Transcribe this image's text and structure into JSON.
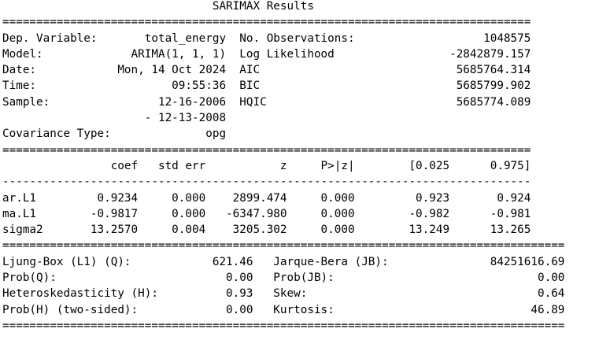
{
  "title": "SARIMAX Results",
  "sections": {
    "top_rule": "==============================================================================",
    "mid_rule": "==============================================================================",
    "dash_rule": "------------------------------------------------------------------------------",
    "bottom_rule_params": "===================================================================================",
    "bottom_rule_final": "==================================================================================="
  },
  "model_info": [
    {
      "left_label": "Dep. Variable:",
      "left_value": "total_energy",
      "right_label": "No. Observations:",
      "right_value": "1048575"
    },
    {
      "left_label": "Model:",
      "left_value": "ARIMA(1, 1, 1)",
      "right_label": "Log Likelihood",
      "right_value": "-2842879.157"
    },
    {
      "left_label": "Date:",
      "left_value": "Mon, 14 Oct 2024",
      "right_label": "AIC",
      "right_value": "5685764.314"
    },
    {
      "left_label": "Time:",
      "left_value": "09:55:36",
      "right_label": "BIC",
      "right_value": "5685799.902"
    },
    {
      "left_label": "Sample:",
      "left_value": "12-16-2006",
      "right_label": "HQIC",
      "right_value": "5685774.089"
    },
    {
      "left_label": "",
      "left_value": "- 12-13-2008",
      "right_label": "",
      "right_value": ""
    },
    {
      "left_label": "Covariance Type:",
      "left_value": "opg",
      "right_label": "",
      "right_value": ""
    }
  ],
  "coef_table": {
    "headers": [
      "",
      "coef",
      "std err",
      "z",
      "P>|z|",
      "[0.025",
      "0.975]"
    ],
    "rows": [
      [
        "ar.L1",
        "0.9234",
        "0.000",
        "2899.474",
        "0.000",
        "0.923",
        "0.924"
      ],
      [
        "ma.L1",
        "-0.9817",
        "0.000",
        "-6347.980",
        "0.000",
        "-0.982",
        "-0.981"
      ],
      [
        "sigma2",
        "13.2570",
        "0.004",
        "3205.302",
        "0.000",
        "13.249",
        "13.265"
      ]
    ]
  },
  "diagnostics": [
    {
      "left_label": "Ljung-Box (L1) (Q):",
      "left_value": "621.46",
      "right_label": "Jarque-Bera (JB):",
      "right_value": "84251616.69"
    },
    {
      "left_label": "Prob(Q):",
      "left_value": "0.00",
      "right_label": "Prob(JB):",
      "right_value": "0.00"
    },
    {
      "left_label": "Heteroskedasticity (H):",
      "left_value": "0.93",
      "right_label": "Skew:",
      "right_value": "0.64"
    },
    {
      "left_label": "Prob(H) (two-sided):",
      "left_value": "0.00",
      "right_label": "Kurtosis:",
      "right_value": "46.89"
    }
  ]
}
